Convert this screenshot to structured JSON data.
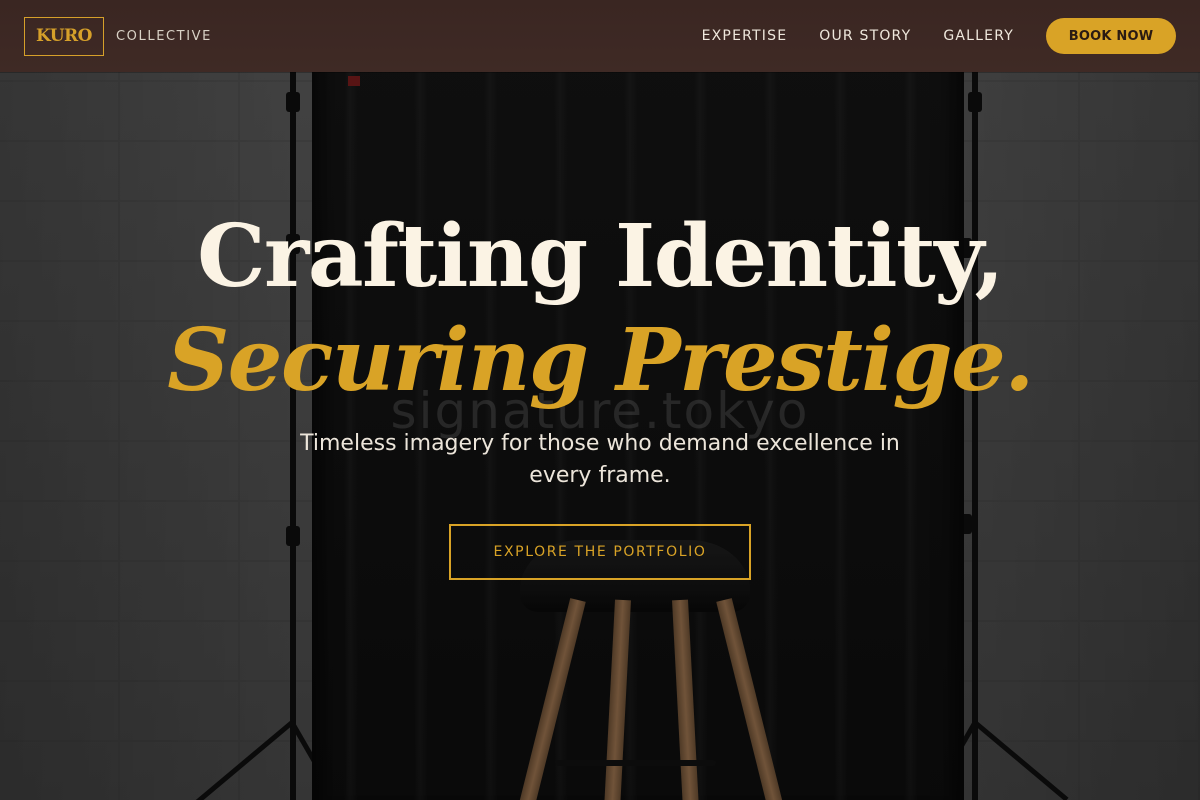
{
  "header": {
    "logo_text": "KURO",
    "brand_subtitle": "COLLECTIVE",
    "nav": [
      {
        "label": "EXPERTISE"
      },
      {
        "label": "OUR STORY"
      },
      {
        "label": "GALLERY"
      }
    ],
    "book_label": "BOOK NOW"
  },
  "hero": {
    "headline_line1": "Crafting Identity,",
    "headline_line2": "Securing Prestige.",
    "subtext": "Timeless imagery for those who demand excellence in every frame.",
    "cta_label": "EXPLORE THE PORTFOLIO",
    "watermark": "signature.tokyo"
  },
  "colors": {
    "accent_gold": "#d9a326",
    "header_bg": "#3f2a25",
    "headline_cream": "#fbf3e4"
  }
}
